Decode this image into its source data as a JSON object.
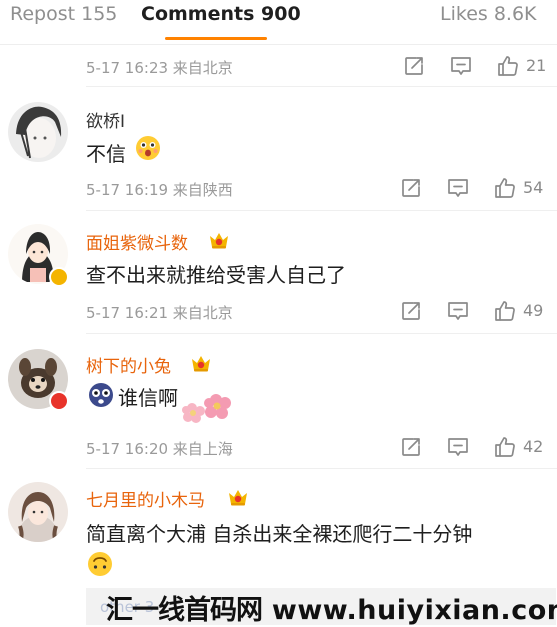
{
  "tabs": [
    {
      "label": "Repost 155"
    },
    {
      "label": "Comments 900"
    },
    {
      "label": "Likes 8.6K"
    }
  ],
  "colors": {
    "tab_accent": "#ff8200",
    "username_vip": "#e8640c",
    "meta_gray": "#9a9a9a",
    "badge_gold": "#f4b400",
    "badge_red": "#e8332a"
  },
  "top_stub": {
    "meta": "5-17 16:23 来自北京",
    "likes": "21"
  },
  "comments": [
    {
      "username": "欲桥I",
      "text": "不信",
      "emoji": "surprised-face-emoji",
      "meta": "5-17 16:19 来自陕西",
      "likes": "54"
    },
    {
      "username": "面姐紫微斗数",
      "text": "查不出来就推给受害人自己了",
      "meta": "5-17 16:21 来自北京",
      "likes": "49"
    },
    {
      "username": "树下的小兔",
      "text": "谁信啊",
      "emoji": "shocked-face-emoji",
      "meta": "5-17 16:20 来自上海",
      "likes": "42"
    },
    {
      "username": "七月里的小木马",
      "text": "简直离个大浦 自杀出来全裸还爬行二十分钟",
      "emoji": "upside-down-face-emoji"
    }
  ],
  "footer": {
    "ghost_text": "other 3"
  },
  "watermark": {
    "cn": "汇一线首码网",
    "url": "www.huiyixian.com"
  }
}
